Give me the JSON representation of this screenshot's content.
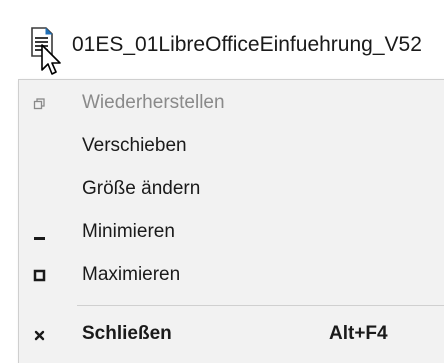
{
  "window": {
    "title": "01ES_01LibreOfficeEinfuehrung_V52"
  },
  "menu": {
    "items": [
      {
        "label": "Wiederherstellen",
        "icon": "restore-icon",
        "disabled": true
      },
      {
        "label": "Verschieben",
        "icon": "",
        "disabled": false
      },
      {
        "label": "Größe ändern",
        "icon": "",
        "disabled": false
      },
      {
        "label": "Minimieren",
        "icon": "minimize-icon",
        "disabled": false
      },
      {
        "label": "Maximieren",
        "icon": "maximize-icon",
        "disabled": false
      },
      {
        "label": "Schließen",
        "icon": "close-icon",
        "disabled": false,
        "shortcut": "Alt+F4",
        "bold": true
      }
    ]
  },
  "colors": {
    "menu_background": "#f2f2f2",
    "text": "#1a1a1a",
    "disabled_text": "#8a8a8a",
    "document_icon_accent": "#1f6fb7"
  }
}
